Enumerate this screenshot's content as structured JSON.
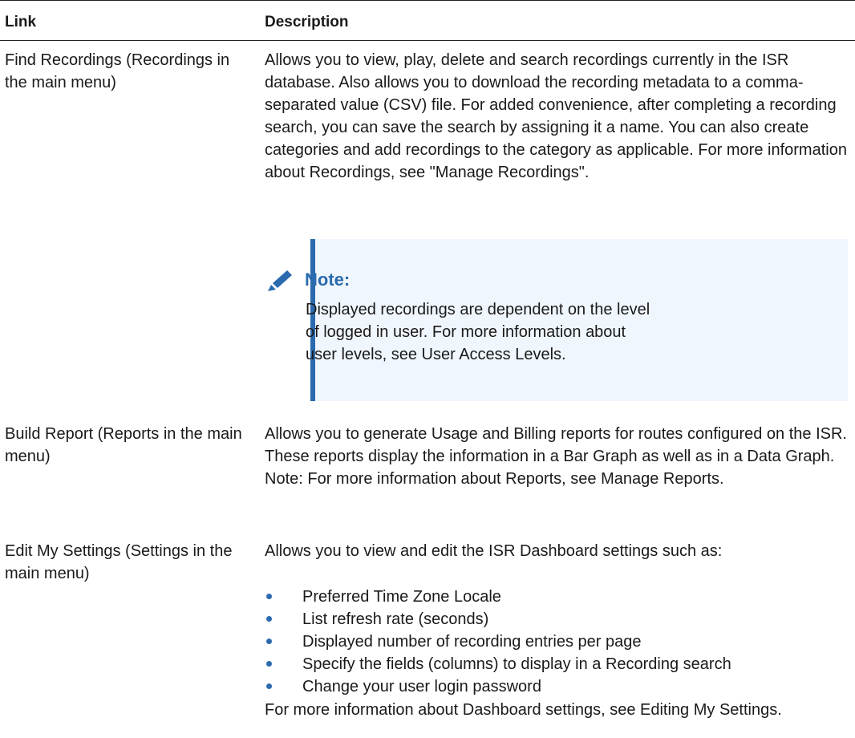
{
  "table": {
    "headers": {
      "link": "Link",
      "description": "Description"
    },
    "rows": [
      {
        "link": "Find Recordings (Recordings in the main menu)",
        "description": "Allows you to view, play, delete and search recordings currently in the ISR database. Also allows you to download the recording metadata to a comma-separated value (CSV) file. For added convenience, after completing a recording search, you can save the search by assigning it a name. You can also create categories and add recordings to the category as applicable. For more information about Recordings, see \"Manage Recordings\".",
        "note": {
          "title": "Note:",
          "icon": "pencil-icon",
          "text": "Displayed recordings are dependent on the level of logged in user. For more information about user levels, see User Access Levels."
        }
      },
      {
        "link": "Build Report (Reports in the main menu)",
        "description": "Allows you to generate Usage and Billing reports for routes configured on the ISR. These reports display the information in a Bar Graph as well as in a Data Graph.",
        "extra": "Note: For more information about Reports, see Manage Reports."
      },
      {
        "link": "Edit My Settings (Settings in the main menu)",
        "description": "Allows you to view and edit the ISR Dashboard settings such as:",
        "bullets": [
          "Preferred Time Zone Locale",
          "List refresh rate (seconds)",
          "Displayed number of recording entries per page",
          "Specify the fields (columns) to display in a Recording search",
          "Change your user login password"
        ],
        "footer": "For more information about Dashboard settings, see Editing My Settings."
      }
    ]
  },
  "colors": {
    "accent": "#2b6aae",
    "note_bg": "#f0f6fd",
    "rule": "#222222"
  }
}
